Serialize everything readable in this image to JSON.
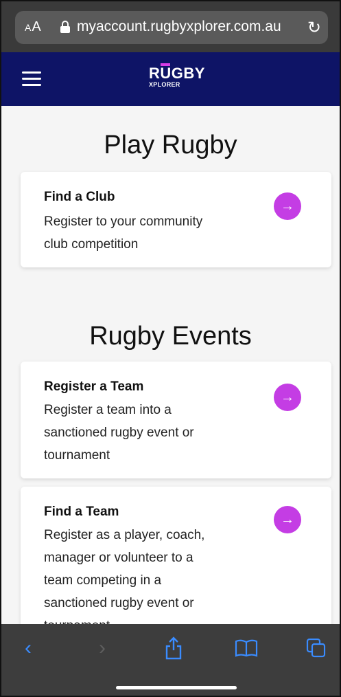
{
  "browser": {
    "aa_label": "AA",
    "url": "myaccount.rugbyxplorer.com.au"
  },
  "header": {
    "logo_line1": "RUGBY",
    "logo_line2": "XPLORER",
    "bg_color": "#0e1466",
    "accent_color": "#c43de4"
  },
  "play_rugby": {
    "title": "Play Rugby",
    "cards": [
      {
        "title": "Find a Club",
        "desc": "Register to your community club competition"
      }
    ]
  },
  "rugby_events": {
    "title": "Rugby Events",
    "cards": [
      {
        "title": "Register a Team",
        "desc": "Register a team into a sanctioned rugby event or tournament"
      },
      {
        "title": "Find a Team",
        "desc": "Register as a player, coach, manager or volunteer to a team competing in a sanctioned rugby event or tournament"
      }
    ]
  },
  "toolbar": {
    "icons": [
      "back-icon",
      "forward-icon",
      "share-icon",
      "bookmarks-icon",
      "tabs-icon"
    ]
  }
}
